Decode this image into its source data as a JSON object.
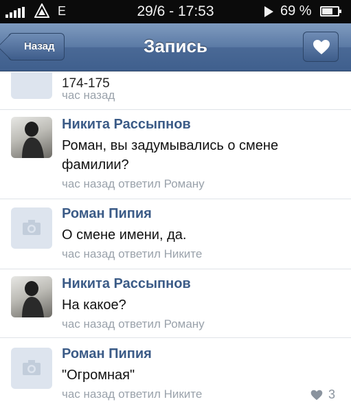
{
  "status_bar": {
    "network": "E",
    "datetime": "29/6 - 17:53",
    "battery": "69 %",
    "battery_level": 0.69
  },
  "nav": {
    "back_label": "Назад",
    "title": "Запись"
  },
  "comments": [
    {
      "author": "",
      "text": "174-175",
      "meta": "час назад",
      "avatar": "placeholder"
    },
    {
      "author": "Никита Рассыпнов",
      "text": "Роман, вы задумывались о смене фамилии?",
      "meta": "час назад ответил Роману",
      "avatar": "photo"
    },
    {
      "author": "Роман Пипия",
      "text": "О смене имени, да.",
      "meta": "час назад ответил Никите",
      "avatar": "placeholder"
    },
    {
      "author": "Никита Рассыпнов",
      "text": "На какое?",
      "meta": "час назад ответил Роману",
      "avatar": "photo"
    },
    {
      "author": "Роман Пипия",
      "text": "\"Огромная\"",
      "meta": "час назад ответил Никите",
      "avatar": "placeholder",
      "likes": "3"
    }
  ]
}
